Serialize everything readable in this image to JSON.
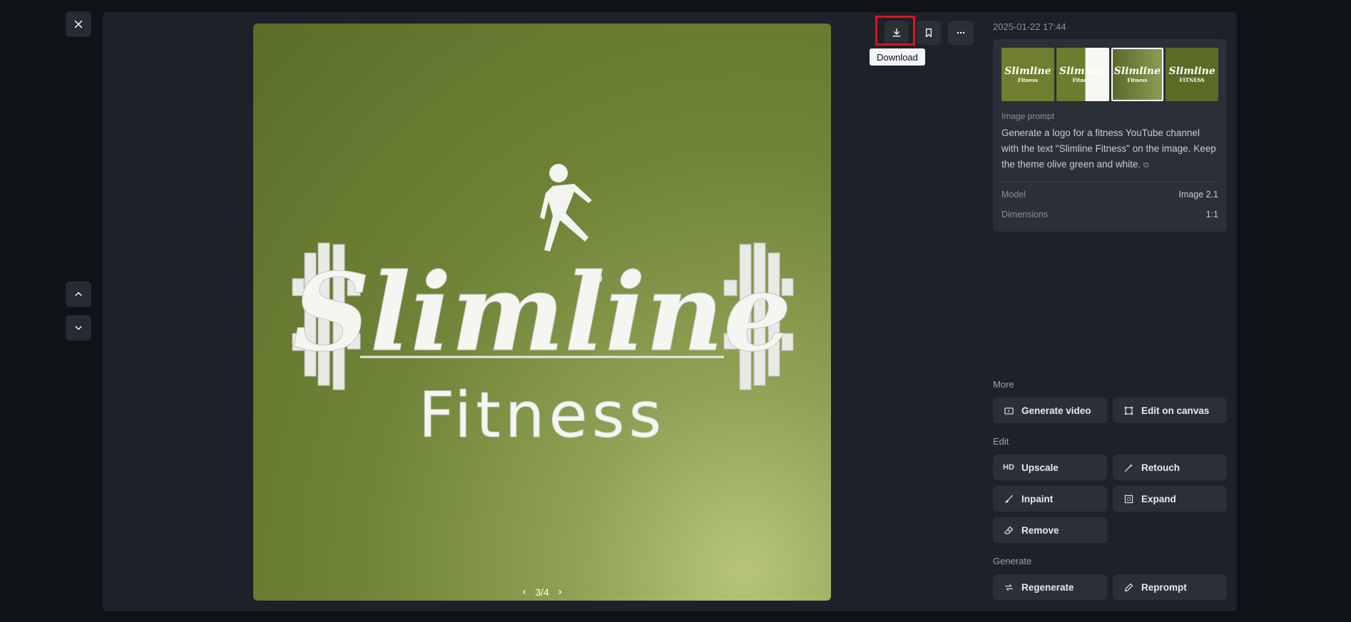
{
  "window": {
    "close_icon": "close-icon",
    "nav_up_icon": "chevron-up-icon",
    "nav_down_icon": "chevron-down-icon"
  },
  "image": {
    "logo_main": "Slimline",
    "logo_sub": "Fitness",
    "pager": {
      "current": "3/4",
      "prev_icon": "chevron-left-icon",
      "next_icon": "chevron-right-icon"
    }
  },
  "toolbar": {
    "download_icon": "download-icon",
    "bookmark_icon": "bookmark-icon",
    "more_icon": "more-horizontal-icon",
    "download_tooltip": "Download"
  },
  "details": {
    "timestamp": "2025-01-22 17:44",
    "thumbnails": [
      {
        "title": "Slimline",
        "sub": "Fitness"
      },
      {
        "title": "Slimline",
        "sub": "Fitness"
      },
      {
        "title": "Slimline",
        "sub": "Fitness"
      },
      {
        "title": "Slimline",
        "sub": "FITNESS"
      }
    ],
    "selected_thumbnail": 3,
    "prompt_label": "Image prompt",
    "prompt_text": "Generate a logo for a fitness YouTube channel with the text \"Slimline Fitness\" on the image. Keep the theme olive green and white.",
    "model_label": "Model",
    "model_value": "Image 2.1",
    "dimensions_label": "Dimensions",
    "dimensions_value": "1:1"
  },
  "sections": {
    "more": {
      "title": "More",
      "items": [
        {
          "label": "Generate video",
          "icon": "video-icon"
        },
        {
          "label": "Edit on canvas",
          "icon": "canvas-icon"
        }
      ]
    },
    "edit": {
      "title": "Edit",
      "items": [
        {
          "label": "Upscale",
          "icon": "hd-icon",
          "icon_text": "HD"
        },
        {
          "label": "Retouch",
          "icon": "magic-wand-icon"
        },
        {
          "label": "Inpaint",
          "icon": "brush-icon"
        },
        {
          "label": "Expand",
          "icon": "expand-icon"
        },
        {
          "label": "Remove",
          "icon": "eraser-icon"
        }
      ]
    },
    "generate": {
      "title": "Generate",
      "items": [
        {
          "label": "Regenerate",
          "icon": "refresh-icon"
        },
        {
          "label": "Reprompt",
          "icon": "pencil-icon"
        }
      ]
    }
  },
  "colors": {
    "highlight": "#e0121f",
    "panel": "#1d212a",
    "background": "#0f1217",
    "olive": "#6f8438"
  }
}
